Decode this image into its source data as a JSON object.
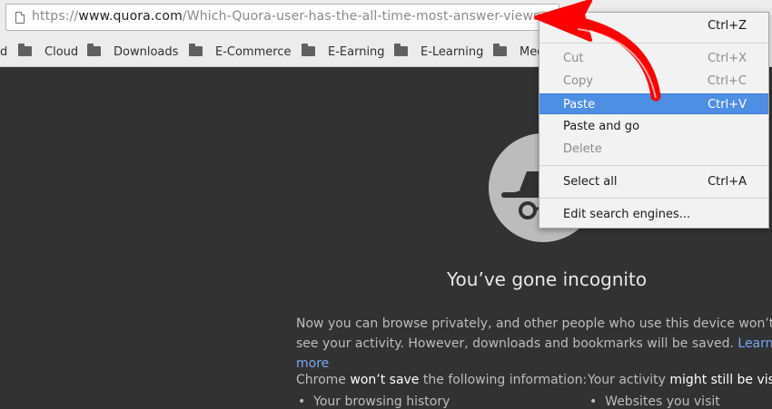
{
  "address_bar": {
    "scheme": "https://",
    "host": "www.quora.com",
    "path": "/Which-Quora-user-has-the-all-time-most-answer-views"
  },
  "bookmarks": {
    "partial_item": "d",
    "folders": [
      "Cloud",
      "Downloads",
      "E-Commerce",
      "E-Earning",
      "E-Learning",
      "Med"
    ]
  },
  "incognito": {
    "headline": "You’ve gone incognito",
    "paragraph": "Now you can browse privately, and other people who use this device won’t see your activity. However, downloads and bookmarks will be saved.",
    "learn_more": "Learn more",
    "left_col": {
      "prefix": "Chrome ",
      "strong": "won’t save",
      "suffix": " the following information:",
      "item": "Your browsing history"
    },
    "right_col": {
      "prefix": "Your activity ",
      "strong": "might still be visible",
      "item": "Websites you visit"
    }
  },
  "context_menu": {
    "items": [
      {
        "label": "Undo",
        "shortcut": "Ctrl+Z"
      },
      {
        "label": "Cut",
        "shortcut": "Ctrl+X"
      },
      {
        "label": "Copy",
        "shortcut": "Ctrl+C"
      },
      {
        "label": "Paste",
        "shortcut": "Ctrl+V"
      },
      {
        "label": "Paste and go",
        "shortcut": ""
      },
      {
        "label": "Delete",
        "shortcut": ""
      },
      {
        "label": "Select all",
        "shortcut": "Ctrl+A"
      },
      {
        "label": "Edit search engines...",
        "shortcut": ""
      }
    ]
  },
  "colors": {
    "highlight": "#4c8fe3",
    "arrow": "#ff0000",
    "link": "#7aa7f0"
  }
}
